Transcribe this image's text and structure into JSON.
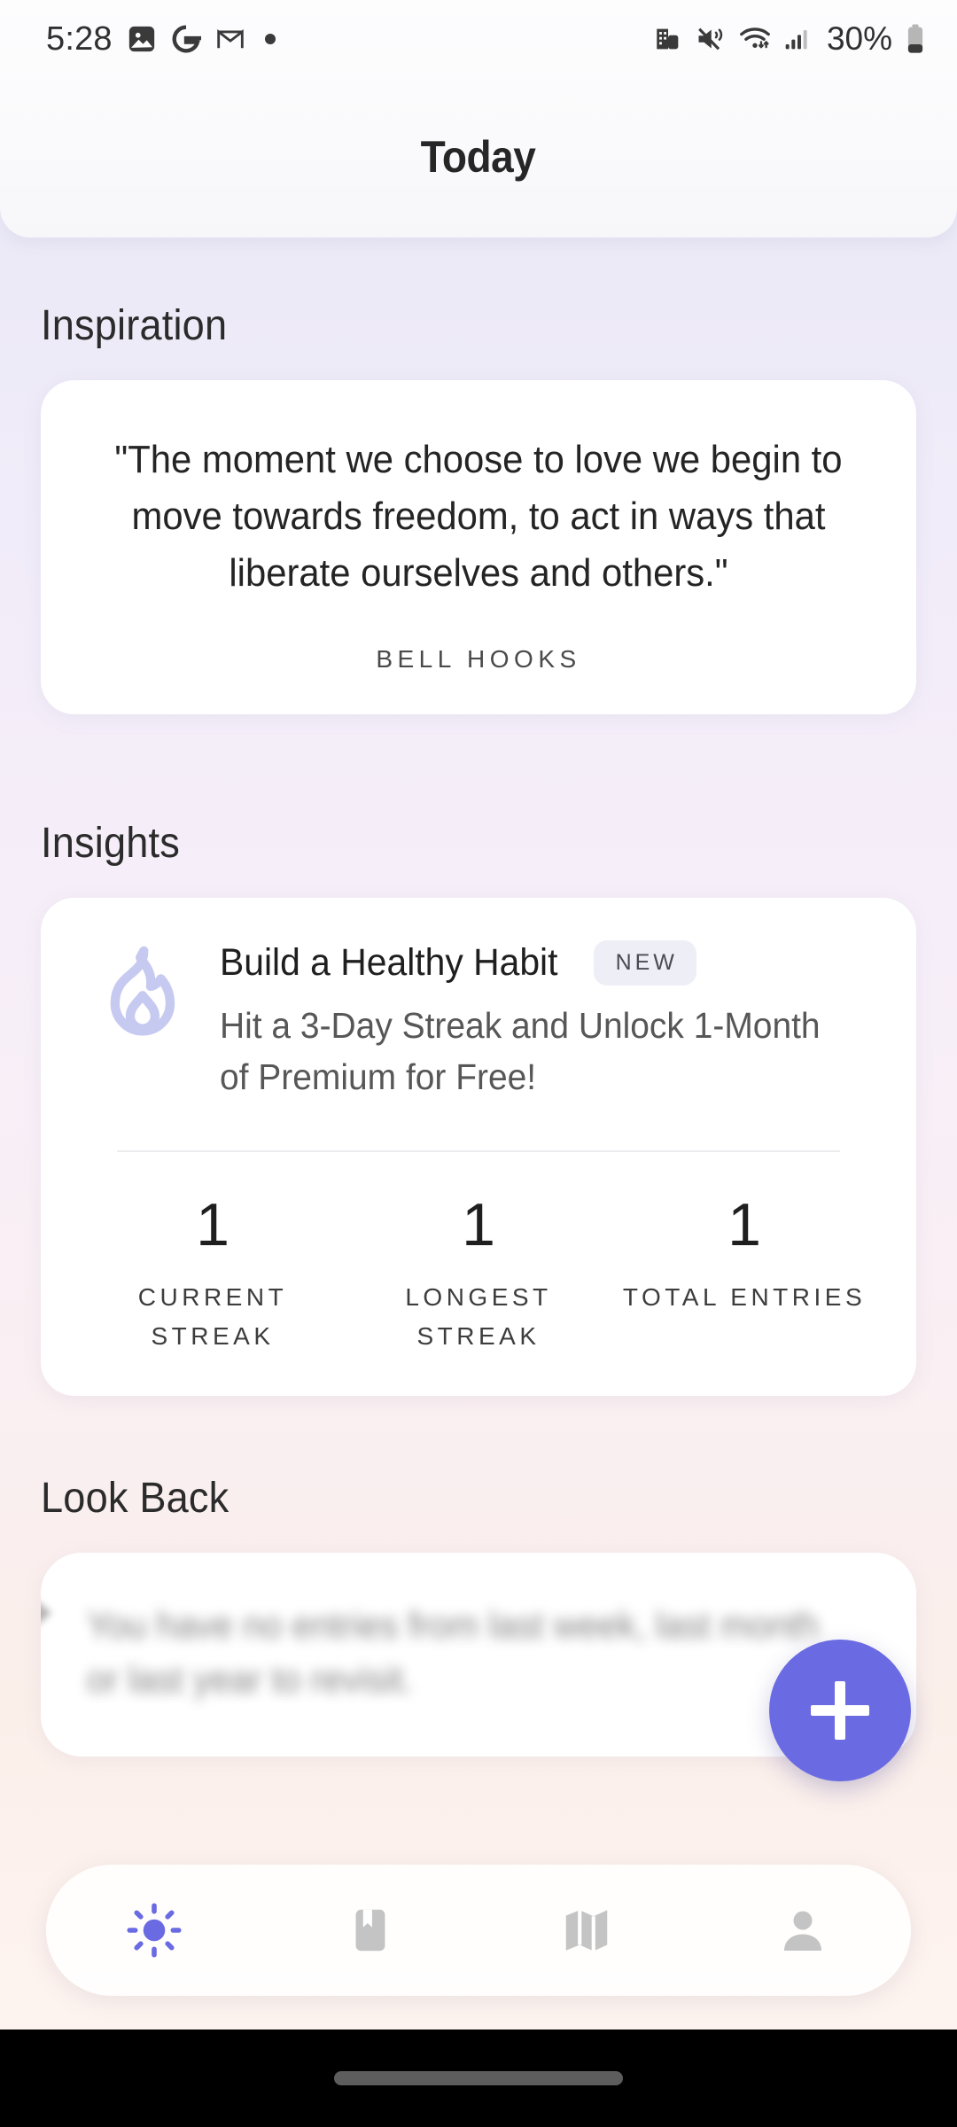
{
  "statusbar": {
    "time": "5:28",
    "battery_percent": "30%",
    "left_icons": [
      "photos-icon",
      "google-icon",
      "gmail-icon",
      "notification-dot-icon"
    ],
    "right_icons": [
      "work-profile-icon",
      "vibrate-mute-icon",
      "wifi-icon",
      "cellular-signal-icon",
      "battery-icon"
    ]
  },
  "header": {
    "title": "Today"
  },
  "inspiration": {
    "section_title": "Inspiration",
    "quote": "\"The moment we choose to love we begin to move towards freedom, to act in ways that liberate ourselves and others.\"",
    "author": "BELL HOOKS"
  },
  "insights": {
    "section_title": "Insights",
    "icon": "flame-icon",
    "title": "Build a Healthy Habit",
    "badge": "NEW",
    "subtitle": "Hit a 3-Day Streak and Unlock 1-Month of Premium for Free!",
    "stats": [
      {
        "value": "1",
        "label": "CURRENT STREAK"
      },
      {
        "value": "1",
        "label": "LONGEST STREAK"
      },
      {
        "value": "1",
        "label": "TOTAL ENTRIES"
      }
    ]
  },
  "lookback": {
    "section_title": "Look Back",
    "empty_text": "You have no entries from last week, last month or last year to revisit."
  },
  "fab": {
    "icon": "plus-icon",
    "label": "New entry",
    "color": "#6a6ae3"
  },
  "bottom_nav": {
    "items": [
      {
        "icon": "sun-icon",
        "name": "today",
        "active": true
      },
      {
        "icon": "journal-bookmark-icon",
        "name": "journal",
        "active": false
      },
      {
        "icon": "map-icon",
        "name": "map",
        "active": false
      },
      {
        "icon": "person-icon",
        "name": "profile",
        "active": false
      }
    ],
    "active_color": "#6a6ae3",
    "inactive_color": "#c4c4c4"
  },
  "system": {
    "gesture_bar": "home-gesture-pill"
  }
}
